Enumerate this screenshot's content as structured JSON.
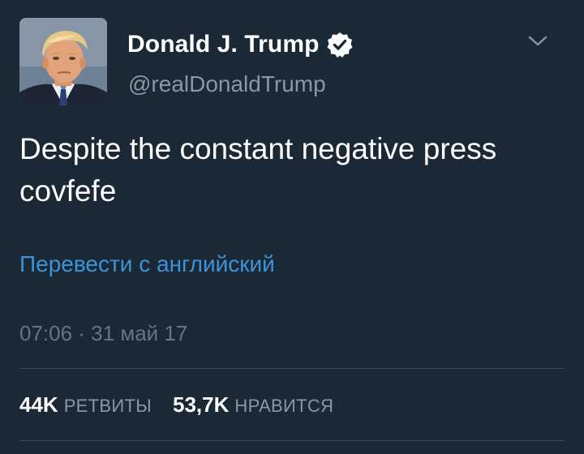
{
  "author": {
    "display_name": "Donald J. Trump",
    "handle": "@realDonaldTrump",
    "verified": true
  },
  "tweet": {
    "text_lines": [
      "Despite the constant negative press",
      "covfefe"
    ],
    "translate_label": "Перевести с английский",
    "timestamp": "07:06 · 31 май 17"
  },
  "stats": {
    "retweets_count": "44K",
    "retweets_label": "РЕТВИТЫ",
    "likes_count": "53,7K",
    "likes_label": "НРАВИТСЯ"
  },
  "icons": {
    "verified": "verified-badge-icon",
    "menu": "chevron-down-icon"
  },
  "colors": {
    "background": "#1b2836",
    "text": "#ffffff",
    "muted": "#8899a6",
    "link": "#3b94d9",
    "divider": "#3a4958"
  }
}
